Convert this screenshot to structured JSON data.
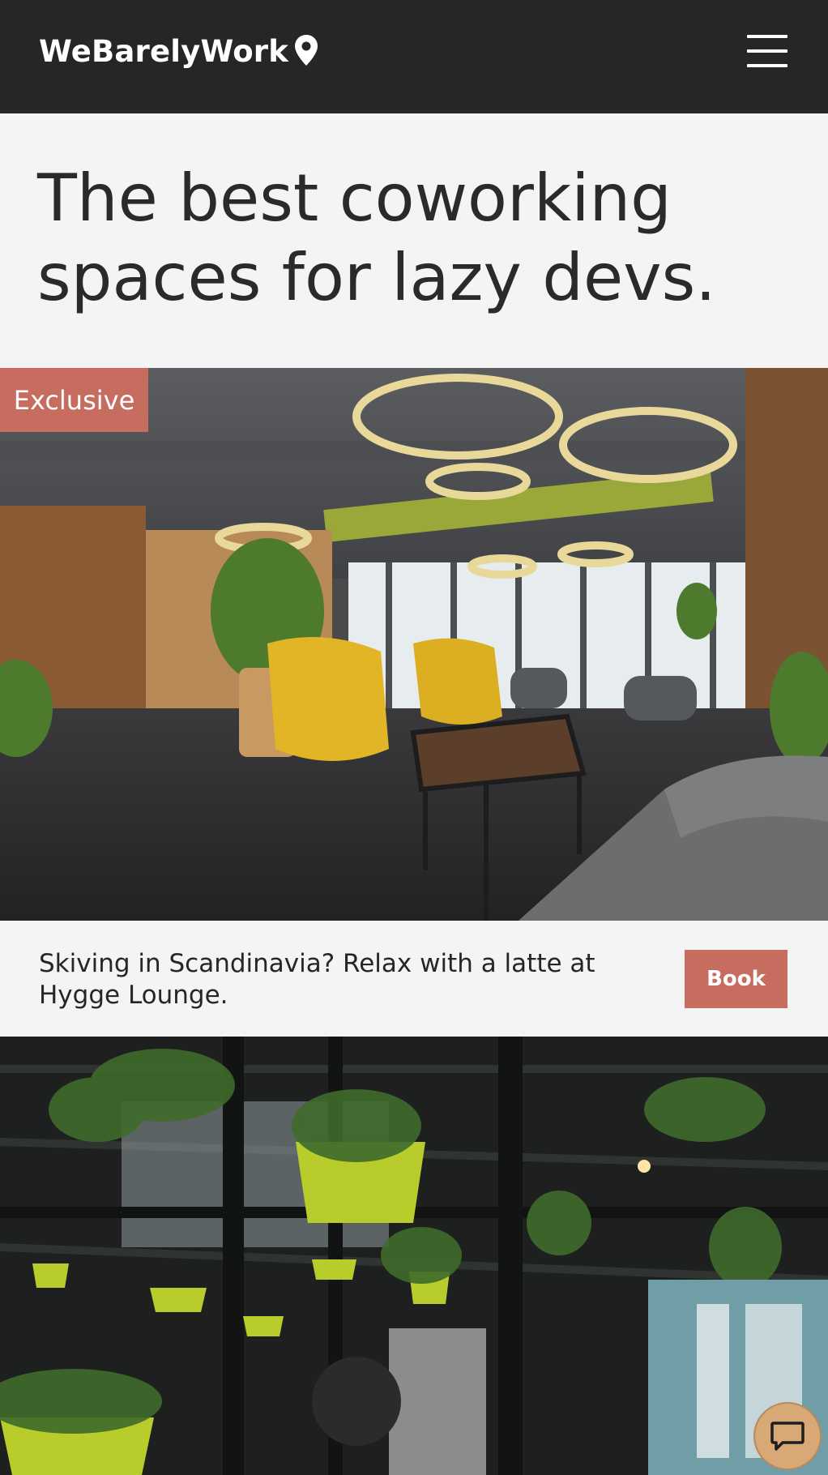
{
  "header": {
    "brand": "WeBarelyWork",
    "location_icon": "map-pin-icon",
    "menu_icon": "hamburger-menu-icon"
  },
  "hero": {
    "title": "The best coworking spaces for lazy devs."
  },
  "listings": [
    {
      "badge": "Exclusive",
      "description": "Skiving in Scandinavia? Relax with a latte at Hygge Lounge.",
      "book_label": "Book"
    }
  ],
  "chat": {
    "icon": "chat-bubble-icon"
  },
  "colors": {
    "header_bg": "#262626",
    "accent": "#c66d60",
    "page_bg": "#f4f4f5",
    "chat_button": "#d9a877"
  }
}
